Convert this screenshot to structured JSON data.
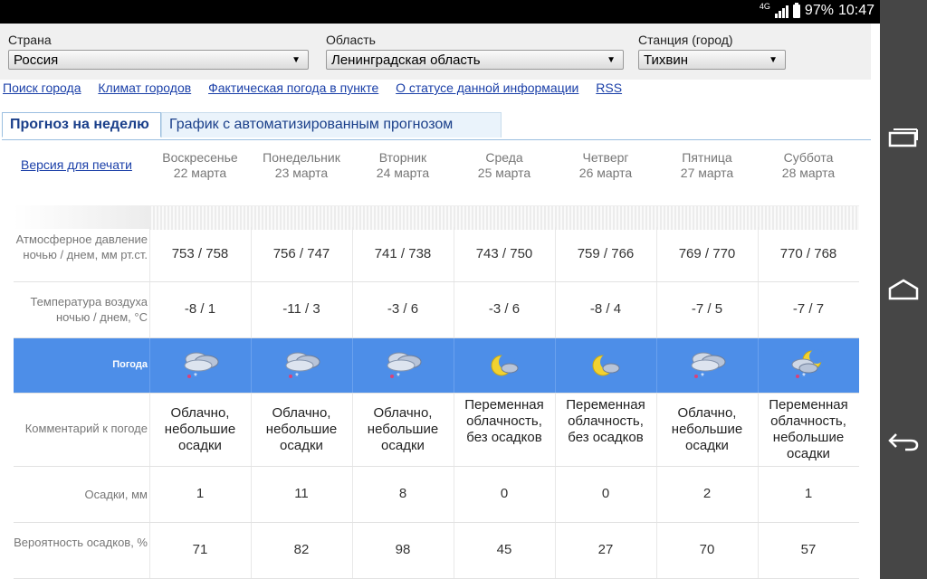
{
  "statusbar": {
    "network": "4G",
    "battery": "97%",
    "time": "10:47"
  },
  "filters": {
    "country_label": "Страна",
    "country_value": "Россия",
    "region_label": "Область",
    "region_value": "Ленинградская область",
    "station_label": "Станция (город)",
    "station_value": "Тихвин"
  },
  "links": [
    "Поиск города",
    "Климат городов",
    "Фактическая погода в пункте",
    "О статусе данной информации",
    "RSS"
  ],
  "tabs": {
    "active": "Прогноз на неделю",
    "inactive": "График с автоматизированным прогнозом"
  },
  "print_link": "Версия для печати",
  "labels": {
    "pressure": "Атмосферное давление ночью / днем, мм рт.ст.",
    "temperature": "Температура воздуха ночью / днем, °С",
    "weather": "Погода",
    "comment": "Комментарий к погоде",
    "precip": "Осадки, мм",
    "probability": "Вероятность осадков, %"
  },
  "days": [
    {
      "name": "Воскресенье",
      "date": "22 марта",
      "pressure": "753 / 758",
      "temp": "-8 / 1",
      "icon": "cloud-snow-icon",
      "comment": "Облачно, небольшие осадки",
      "precip": "1",
      "prob": "71"
    },
    {
      "name": "Понедельник",
      "date": "23 марта",
      "pressure": "756 / 747",
      "temp": "-11 / 3",
      "icon": "cloud-snow-icon",
      "comment": "Облачно, небольшие осадки",
      "precip": "11",
      "prob": "82"
    },
    {
      "name": "Вторник",
      "date": "24 марта",
      "pressure": "741 / 738",
      "temp": "-3 / 6",
      "icon": "cloud-snow-icon",
      "comment": "Облачно, небольшие осадки",
      "precip": "8",
      "prob": "98"
    },
    {
      "name": "Среда",
      "date": "25 марта",
      "pressure": "743 / 750",
      "temp": "-3 / 6",
      "icon": "moon-cloud-icon",
      "comment": "Переменная облачность, без осадков",
      "precip": "0",
      "prob": "45"
    },
    {
      "name": "Четверг",
      "date": "26 марта",
      "pressure": "759 / 766",
      "temp": "-8 / 4",
      "icon": "moon-cloud-icon",
      "comment": "Переменная облачность, без осадков",
      "precip": "0",
      "prob": "27"
    },
    {
      "name": "Пятница",
      "date": "27 марта",
      "pressure": "769 / 770",
      "temp": "-7 / 5",
      "icon": "cloud-snow-icon",
      "comment": "Облачно, небольшие осадки",
      "precip": "2",
      "prob": "70"
    },
    {
      "name": "Суббота",
      "date": "28 марта",
      "pressure": "770 / 768",
      "temp": "-7 / 7",
      "icon": "moon-cloud-snow-icon",
      "comment": "Переменная облачность, небольшие осадки",
      "precip": "1",
      "prob": "57"
    }
  ],
  "colors": {
    "accent": "#4d8ee8",
    "link": "#1a3fa8",
    "tab_text": "#1a3f8a"
  }
}
